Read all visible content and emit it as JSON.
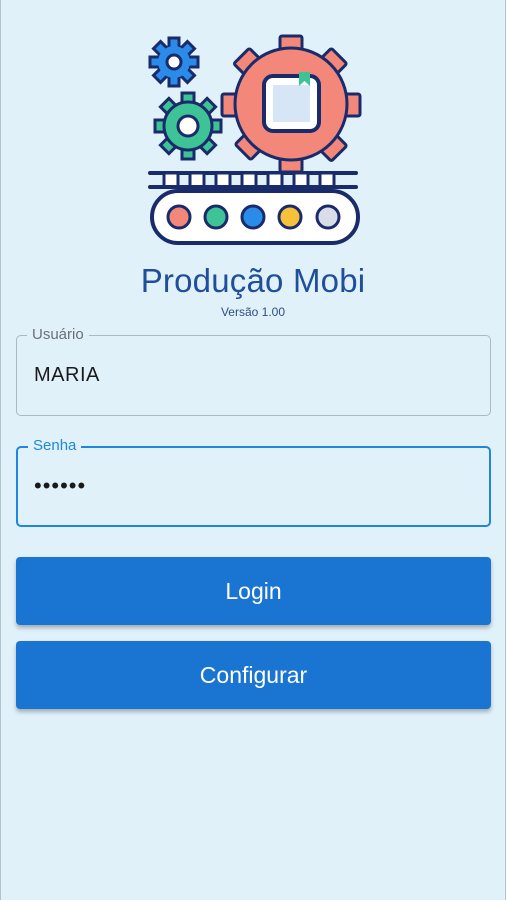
{
  "app": {
    "title": "Produção Mobi",
    "version": "Versão 1.00"
  },
  "login_form": {
    "user_label": "Usuário",
    "user_value": "MARIA",
    "password_label": "Senha",
    "password_value": "••••••",
    "login_button": "Login",
    "config_button": "Configurar"
  },
  "logo": {
    "icon": "factory-gears-conveyor-icon",
    "conveyor_item_colors": [
      "#f2877a",
      "#3ec396",
      "#2b8be8",
      "#f7c23a",
      "#d9dde8"
    ]
  },
  "colors": {
    "background": "#e1f1fa",
    "primary": "#1a74d1",
    "title": "#1f4e9b",
    "gear_large": "#f2877a",
    "gear_medium": "#3ec396",
    "gear_small": "#2b8be8",
    "outline": "#1a2b6b"
  }
}
